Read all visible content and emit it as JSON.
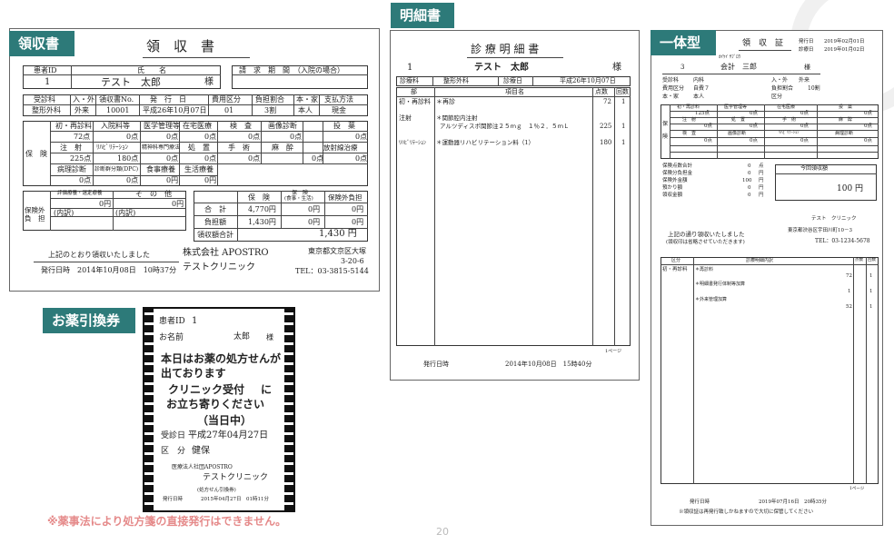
{
  "labels": {
    "receipt": "領収書",
    "detail": "明細書",
    "combined": "一体型",
    "rx": "お薬引換券"
  },
  "receipt": {
    "title": "領　収　書",
    "h_id": "患者ID",
    "h_name": "氏　　名",
    "h_period": "請　求　期　間　（入院の場合）",
    "id": "1",
    "name": "テスト　太郎",
    "sama": "様",
    "h2": [
      "受診科",
      "入・外",
      "領収書No.",
      "発　行　日",
      "費用区分",
      "負担割合",
      "本・家",
      "支払方法"
    ],
    "r2": [
      "整形外科",
      "外来",
      "10001",
      "平成26年10月07日",
      "01",
      "3割",
      "本人",
      "現金"
    ],
    "hoken": "保　険",
    "g1h": [
      "初・再診料",
      "入院料等",
      "医学管理等",
      "在宅医療",
      "検　査",
      "画像診断",
      "投　薬"
    ],
    "g1v": [
      "72点",
      "0点",
      "0点",
      "0点",
      "0点",
      "0点",
      "0点"
    ],
    "g2h": [
      "注　射",
      "ﾘﾊﾋﾞﾘﾃｰｼｮﾝ",
      "精神科専門療法",
      "処　置",
      "手　術",
      "麻　酔",
      "放射線治療"
    ],
    "g2v": [
      "225点",
      "180点",
      "0点",
      "0点",
      "0点",
      "0点",
      "0点"
    ],
    "g3h": [
      "病理診断",
      "診断群分類(DPC)",
      "食事療養",
      "生活療養"
    ],
    "g3v": [
      "0点",
      "0点",
      "0円",
      "0円"
    ],
    "hokengai": "保険外\n負　担",
    "hg_h": [
      "評価療養・選定療養",
      "そ　の　他"
    ],
    "hg_v": [
      "0円",
      "0円"
    ],
    "uchiwake": "(内訳)",
    "sum_h": [
      "保　険",
      "保　険\n(食事・生活)",
      "保険外負担"
    ],
    "sum_rows": [
      [
        "合　計",
        "4,770円",
        "0円",
        "0円"
      ],
      [
        "負担額",
        "1,430円",
        "0円",
        "0円"
      ]
    ],
    "total_label": "領収額合計",
    "total": "1,430 円",
    "received": "上記のとおり領収いたしました",
    "issued": "発行日時　2014年10月08日　10時37分",
    "company": "株式会社 APOSTRO",
    "clinic": "テストクリニック",
    "address1": "東京都文京区大塚",
    "address2": "3-20-6",
    "tel": "TEL：03-3815-5144"
  },
  "detail": {
    "title": "診 療 明 細 書",
    "id": "1",
    "name": "テスト　太郎",
    "sama": "様",
    "h1": [
      "診療科",
      "整形外科",
      "診療日",
      "平成26年10月07日"
    ],
    "cols": [
      "部　　　　　　　　　　　　　　　　　　　項目名",
      "点数",
      "回数"
    ],
    "rows": [
      [
        "初・再診料",
        "＊再診",
        "72",
        "1"
      ],
      [
        "注射",
        "＊関節腔内注射\n　アルツディスポ関節注２５ｍｇ　１％２．５ｍＬ",
        "225",
        "1"
      ],
      [
        "ﾘﾊﾋﾞﾘﾃｰｼｮﾝ",
        "＊運動器リハビリテーション料（1）",
        "180",
        "1"
      ]
    ],
    "page": "1ページ",
    "issued_label": "発行日時",
    "issued": "2014年10月08日　15時40分"
  },
  "combined": {
    "title": "領　収　証",
    "issue_label": "発行日",
    "issue": "2019年02月01日",
    "visit_label": "診療日",
    "visit": "2019年01月02日",
    "kana": "ｶｲｹｲ ｻﾌﾞﾛｳ",
    "id": "3",
    "name": "会計　三郎",
    "sama": "様",
    "info": [
      [
        "受診科",
        "内科",
        "入・外",
        "外来"
      ],
      [
        "費用区分",
        "自費７",
        "負担割合",
        "10割"
      ],
      [
        "本・家",
        "本人",
        "区分",
        ""
      ]
    ],
    "hoken": "保\n\n険",
    "g1h": [
      "初・再診料",
      "医学管理等",
      "在宅医療",
      "投　薬"
    ],
    "g1v": [
      "125点",
      "0点",
      "0点",
      "0点"
    ],
    "g2h": [
      "注　射",
      "処　置",
      "手　術",
      "麻　酔"
    ],
    "g2v": [
      "0点",
      "0点",
      "0点",
      "0点"
    ],
    "g3h": [
      "検　査",
      "画像診断",
      "ﾘﾊﾋﾞﾘﾃｰｼｮﾝ",
      "病理診断"
    ],
    "g3v": [
      "0点",
      "0点",
      "0点",
      "0点"
    ],
    "sums": [
      [
        "保険点数合計",
        "0",
        "点"
      ],
      [
        "保険分負担金",
        "0",
        "円"
      ],
      [
        "保険外金額",
        "100",
        "円"
      ],
      [
        "預かり額",
        "0",
        "円"
      ],
      [
        "領収金額",
        "0",
        "円"
      ]
    ],
    "current_label": "今回領収額",
    "current": "100 円",
    "clinic": "テスト　クリニック",
    "received": "上記の通り領収いたしました",
    "note": "(領収印は省略させていただきます)",
    "address": "東京都渋谷区宇田川町10－3",
    "tel": "TEL：03-1234-5678",
    "cols": [
      "区分",
      "診療明細内訳",
      "点数",
      "回数"
    ],
    "rows": [
      [
        "初・再診料",
        "＊再診料",
        "72",
        "1"
      ],
      [
        "",
        "＊明細書発行体制等加算",
        "1",
        "1"
      ],
      [
        "",
        "＊外来管理加算",
        "52",
        "1"
      ]
    ],
    "page": "1ページ",
    "issued_label": "発行日時",
    "issued": "2019年07月16日　20時35分",
    "footer": "※領収証は再発行致しかねますので大切に保管してください"
  },
  "rx": {
    "id_label": "患者ID",
    "id": "1",
    "name_label": "お名前",
    "name": "太郎",
    "sama": "様",
    "msg1": "本日はお薬の処方せんが",
    "msg2": "出ております",
    "msg3": "クリニック受付",
    "msg3b": "に",
    "msg4": "お立ち寄りください",
    "msg5": "（当日中）",
    "date_label": "受診日",
    "date": "平成27年04月27日",
    "kubun_label": "区　分",
    "kubun": "健保",
    "corp": "医療法人社団APOSTRO",
    "clinic": "テストクリニック",
    "paren": "(処方せん引換券)",
    "issued_label": "発行日時",
    "issued": "2015年04月27日　01時11分"
  },
  "warning": "※薬事法により処方箋の直接発行はできません。",
  "page_number": "20"
}
